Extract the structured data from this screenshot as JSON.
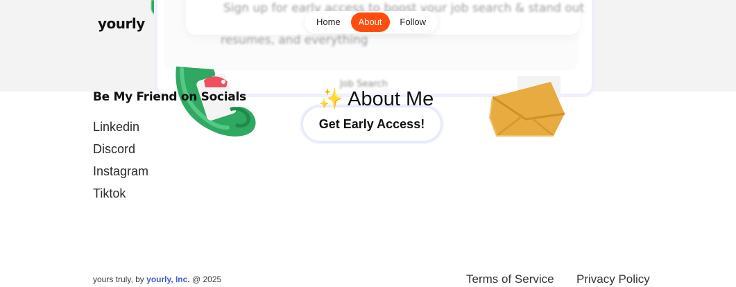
{
  "header": {
    "logo": "yourly",
    "nav": [
      {
        "label": "Home",
        "active": false
      },
      {
        "label": "About",
        "active": true
      },
      {
        "label": "Follow",
        "active": false
      }
    ]
  },
  "background": {
    "ghost_text_1": "Sign up for early access to boost your job search & stand out",
    "ghost_text_2": "resumes, and everything",
    "ghost_text_3": "Job Search"
  },
  "socials": {
    "heading": "Be My Friend on Socials",
    "links": [
      "Linkedin",
      "Discord",
      "Instagram",
      "Tiktok"
    ]
  },
  "about": {
    "title": "About Me",
    "icon": "sparkles-icon",
    "cta": "Get Early Access!"
  },
  "footer": {
    "prefix": "yours truly, by",
    "brand": "yourly, Inc.",
    "suffix": "@ 2025",
    "links": [
      "Terms of Service",
      "Privacy Policy"
    ]
  },
  "colors": {
    "accent": "#ff4d0d",
    "brand_link": "#3f5bd6",
    "envelope": "#e8ab3f",
    "phone": "#2fa862"
  }
}
